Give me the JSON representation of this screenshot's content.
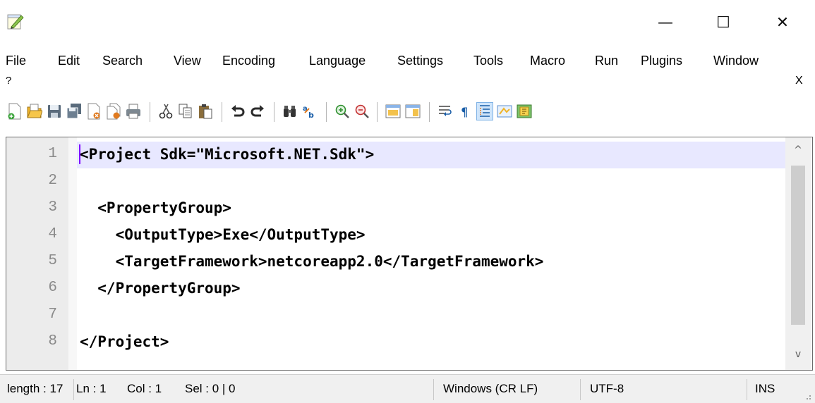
{
  "window": {
    "app_icon": "notepad-plus-plus-icon",
    "minimize_icon": "—",
    "maximize_icon": "☐",
    "close_icon": "✕"
  },
  "menubar": {
    "items": [
      "File",
      "Edit",
      "Search",
      "View",
      "Encoding",
      "Language",
      "Settings",
      "Tools",
      "Macro",
      "Run",
      "Plugins",
      "Window"
    ],
    "help": "?",
    "close_doc": "X"
  },
  "toolbar": {
    "icons": [
      "new-file-icon",
      "open-file-icon",
      "save-icon",
      "save-all-icon",
      "close-icon",
      "close-all-icon",
      "print-icon",
      "cut-icon",
      "copy-icon",
      "paste-icon",
      "undo-icon",
      "redo-icon",
      "find-icon",
      "replace-icon",
      "zoom-in-icon",
      "zoom-out-icon",
      "sync-vertical-icon",
      "sync-horizontal-icon",
      "word-wrap-icon",
      "show-all-chars-icon",
      "indent-guide-icon",
      "doc-map-icon",
      "function-list-icon"
    ]
  },
  "editor": {
    "line_numbers": [
      "1",
      "2",
      "3",
      "4",
      "5",
      "6",
      "7",
      "8"
    ],
    "lines": [
      "<Project Sdk=\"Microsoft.NET.Sdk\">",
      "",
      "  <PropertyGroup>",
      "    <OutputType>Exe</OutputType>",
      "    <TargetFramework>netcoreapp2.0</TargetFramework>",
      "  </PropertyGroup>",
      "",
      "</Project>"
    ],
    "scroll_up": "^",
    "scroll_down": "v"
  },
  "status": {
    "length": "length : 17",
    "ln": "Ln : 1",
    "col": "Col : 1",
    "sel": "Sel : 0 | 0",
    "eol": "Windows (CR LF)",
    "encoding": "UTF-8",
    "mode": "INS"
  }
}
